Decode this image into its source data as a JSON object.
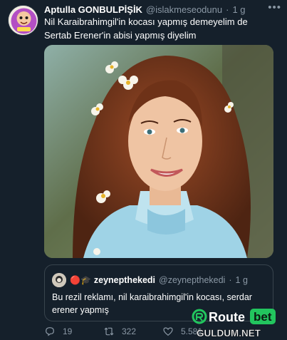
{
  "tweet": {
    "display_name": "Aptulla GONBULPİŞİK",
    "handle": "@islakmeseodunu",
    "separator": "·",
    "time": "1 g",
    "text": "Nil Karaibrahimgil'in kocası yapmış demeyelim de Sertab Erener'in abisi yapmış diyelim",
    "more_glyph": "•••"
  },
  "quote": {
    "emoji": "🔴🎓",
    "display_name": "zeynepthekedi",
    "handle": "@zeynepthekedi",
    "separator": "·",
    "time": "1 g",
    "text": "Bu rezil reklamı, nil karaibrahimgil'in kocası, serdar erener yapmış"
  },
  "actions": {
    "replies": "19",
    "retweets": "322",
    "likes": "5.581"
  },
  "watermark": {
    "brand": "Route",
    "brand_suffix": "bet",
    "site": "GULDUM.NET"
  },
  "colors": {
    "background": "#15202b",
    "secondary_text": "#8b98a5",
    "border": "#38444d",
    "watermark_green": "#22c55e"
  }
}
